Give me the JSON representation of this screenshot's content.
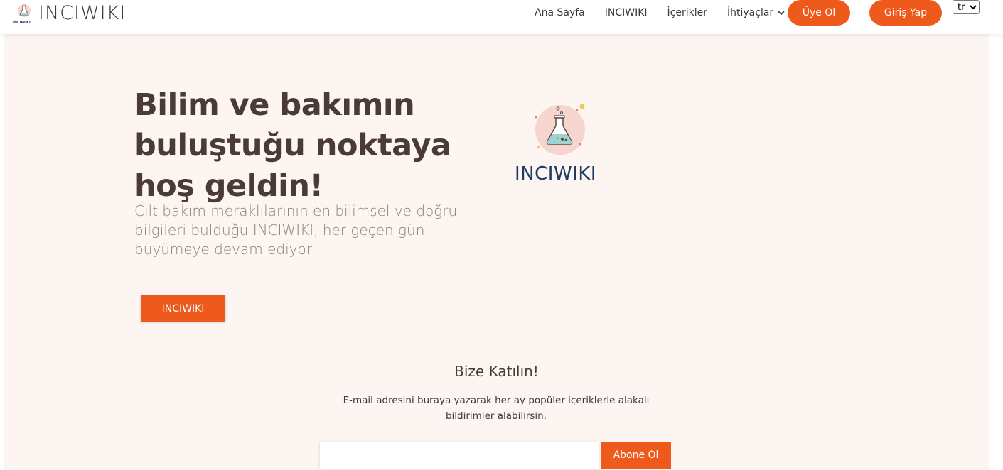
{
  "header": {
    "brand_text": "INCIWIKI",
    "brand_mini": "INCIWIKI",
    "nav": [
      "Ana Sayfa",
      "INCIWIKI",
      "İçerikler",
      "İhtiyaçlar"
    ],
    "signup_label": "Üye Ol",
    "login_label": "Giriş Yap",
    "language": "tr"
  },
  "hero": {
    "title": "Bilim ve bakımın buluştuğu noktaya hoş geldin!",
    "subtitle": "Cilt bakım meraklılarının en bilimsel ve doğru bilgileri bulduğu INCIWIKI, her geçen gün büyümeye devam ediyor.",
    "button_label": "INCIWIKI",
    "logo_word": "INCIWIKI"
  },
  "join": {
    "title": "Bize Katılın!",
    "description": "E-mail adresini buraya yazarak her ay popüler içeriklerle alakalı bildirimler alabilirsin.",
    "email_value": "",
    "subscribe_label": "Abone Ol"
  },
  "colors": {
    "accent": "#ee5a1c",
    "hero_bg": "#fcf5f1",
    "logo_navy": "#1f3b63"
  },
  "icons": [
    "flask-icon",
    "chevron-down-icon"
  ]
}
